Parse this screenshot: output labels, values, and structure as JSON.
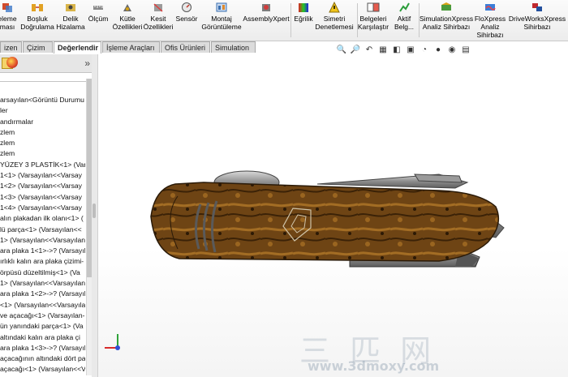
{
  "ribbon": {
    "buttons": [
      {
        "label": "eleme\nması",
        "icon": "interference-icon"
      },
      {
        "label": "Boşluk\nDoğrulama",
        "icon": "clearance-icon"
      },
      {
        "label": "Delik\nHizalama",
        "icon": "hole-align-icon"
      },
      {
        "label": "Ölçüm",
        "icon": "measure-icon"
      },
      {
        "label": "Kütle\nÖzellikleri",
        "icon": "mass-props-icon"
      },
      {
        "label": "Kesit\nÖzellikleri",
        "icon": "section-props-icon"
      },
      {
        "label": "Sensör",
        "icon": "sensor-icon"
      },
      {
        "label": "Montaj\nGörüntüleme",
        "icon": "assembly-vis-icon"
      },
      {
        "label": "AssemblyXpert",
        "icon": "assemblyxpert-icon"
      },
      {
        "label": "Eğrilik",
        "icon": "curvature-icon"
      },
      {
        "label": "Simetri\nDenetlemesi",
        "icon": "symmetry-icon"
      },
      {
        "label": "Belgeleri\nKarşılaştır",
        "icon": "compare-icon"
      },
      {
        "label": "Aktif\nBelg...",
        "icon": "active-doc-icon"
      },
      {
        "label": "SimulationXpress\nAnaliz Sihirbazı",
        "icon": "simulationxpress-icon"
      },
      {
        "label": "FloXpress\nAnaliz\nSihirbazı",
        "icon": "floxpress-icon"
      },
      {
        "label": "DriveWorksXpress\nSihirbazı",
        "icon": "driveworks-icon"
      }
    ]
  },
  "tabs": [
    {
      "label": "izen"
    },
    {
      "label": "Çizim"
    },
    {
      "label": "Değerlendir",
      "active": true
    },
    {
      "label": "İşleme Araçları"
    },
    {
      "label": "Ofis Ürünleri"
    },
    {
      "label": "Simulation"
    }
  ],
  "tree": {
    "collapse": "»",
    "items": [
      "arsayılan<Görüntü Durumu",
      "ler",
      "andırmalar",
      "zlem",
      "zlem",
      "zlem",
      "YÜZEY 3 PLASTİK<1> (Var",
      "1<1> (Varsayılan<<Varsay",
      "1<2> (Varsayılan<<Varsay",
      "1<3> (Varsayılan<<Varsay",
      "1<4> (Varsayılan<<Varsay",
      "alın plakadan ilk olanı<1> (",
      "lü parça<1> (Varsayılan<<",
      "1> (Varsayılan<<Varsayılan",
      "ara plaka 1<1>->? (Varsayıl",
      "ırlıklı kalın ara plaka çizimi-",
      "örpüsü düzeltilmiş<1> (Va",
      "1> (Varsayılan<<Varsayılan",
      "ara plaka 1<2>->? (Varsayıl",
      "<1> (Varsayılan<<Varsayıla",
      "ve açacağı<1> (Varsayılan-",
      "ün yanındaki parça<1> (Va",
      "altındaki kalın ara plaka çi",
      "ara plaka 1<3>->? (Varsayıl",
      "açacağının altındaki dört parç",
      "açacağı<1> (Varsayılan<<V"
    ]
  },
  "watermark": {
    "text": "三 匹 网",
    "sub": "www.3dmoxy.com"
  },
  "colors": {
    "ribbon_bg": "#ececec",
    "knife_wood": "#7a4a16",
    "accent": "#1f5fb5"
  }
}
